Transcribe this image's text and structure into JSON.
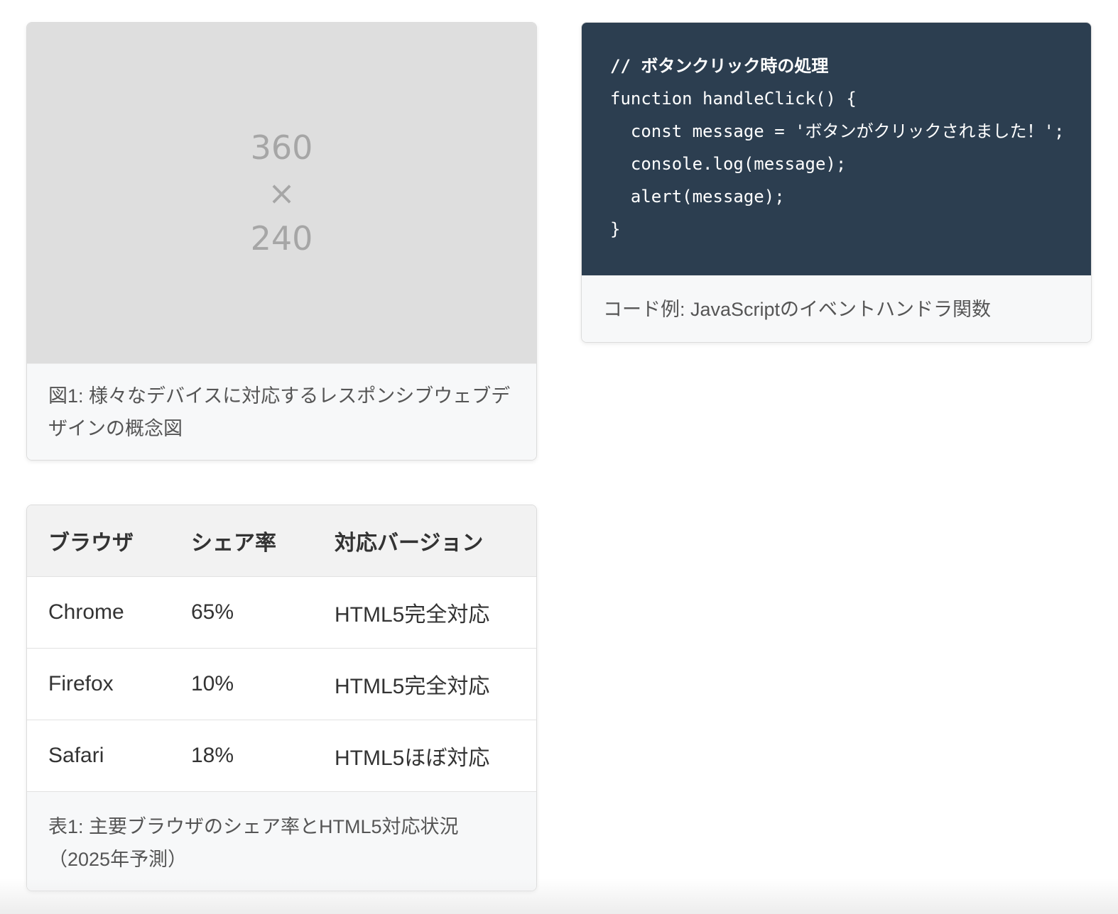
{
  "figure": {
    "placeholder_width": "360",
    "placeholder_times": "×",
    "placeholder_height": "240",
    "caption": "図1: 様々なデバイスに対応するレスポンシブウェブデザインの概念図"
  },
  "code": {
    "lines": [
      "// ボタンクリック時の処理",
      "function handleClick() {",
      "  const message = 'ボタンがクリックされました！';",
      "  console.log(message);",
      "  alert(message);",
      "}"
    ],
    "caption": "コード例: JavaScriptのイベントハンドラ関数"
  },
  "table": {
    "headers": [
      "ブラウザ",
      "シェア率",
      "対応バージョン"
    ],
    "rows": [
      [
        "Chrome",
        "65%",
        "HTML5完全対応"
      ],
      [
        "Firefox",
        "10%",
        "HTML5完全対応"
      ],
      [
        "Safari",
        "18%",
        "HTML5ほぼ対応"
      ]
    ],
    "caption": "表1: 主要ブラウザのシェア率とHTML5対応状況（2025年予測）"
  },
  "colors": {
    "code_background": "#2c3e50",
    "placeholder_background": "#dedede",
    "caption_background": "#f7f8f9"
  }
}
